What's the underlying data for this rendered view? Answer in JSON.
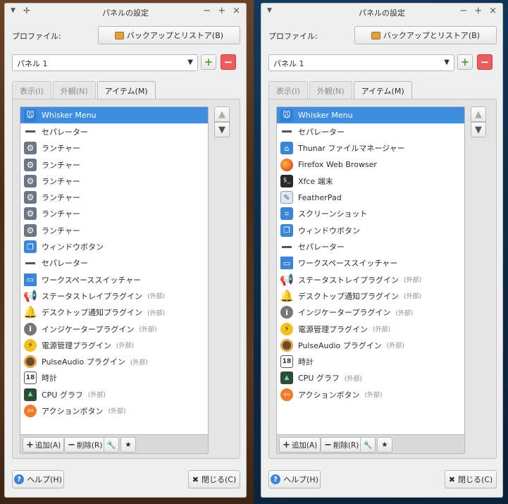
{
  "window": {
    "title": "パネルの設定",
    "profile_label": "プロファイル:",
    "backup_button": "バックアップとリストア(B)",
    "panel_select": "パネル 1",
    "add_symbol": "+",
    "remove_symbol": "−",
    "tabs": [
      "表示(I)",
      "外観(N)",
      "アイテム(M)"
    ],
    "toolbar": {
      "add": "追加(A)",
      "remove": "削除(R)"
    },
    "help_button": "ヘルプ(H)",
    "close_button": "閉じる(C)"
  },
  "left_items": [
    {
      "label": "Whisker Menu",
      "ext": "",
      "icon": "whisker-menu-icon",
      "selected": true
    },
    {
      "label": "セパレーター",
      "ext": "",
      "icon": "separator-icon"
    },
    {
      "label": "ランチャー",
      "ext": "",
      "icon": "launcher-gear-icon"
    },
    {
      "label": "ランチャー",
      "ext": "",
      "icon": "launcher-gear-icon"
    },
    {
      "label": "ランチャー",
      "ext": "",
      "icon": "launcher-gear-icon"
    },
    {
      "label": "ランチャー",
      "ext": "",
      "icon": "launcher-gear-icon"
    },
    {
      "label": "ランチャー",
      "ext": "",
      "icon": "launcher-gear-icon"
    },
    {
      "label": "ランチャー",
      "ext": "",
      "icon": "launcher-gear-icon"
    },
    {
      "label": "ウィンドウボタン",
      "ext": "",
      "icon": "window-buttons-icon"
    },
    {
      "label": "セパレーター",
      "ext": "",
      "icon": "separator-icon"
    },
    {
      "label": "ワークスペーススイッチャー",
      "ext": "",
      "icon": "workspace-switcher-icon"
    },
    {
      "label": "ステータストレイプラグイン",
      "ext": "(外部)",
      "icon": "status-tray-icon"
    },
    {
      "label": "デスクトップ通知プラグイン",
      "ext": "(外部)",
      "icon": "notification-bell-icon"
    },
    {
      "label": "インジケータープラグイン",
      "ext": "(外部)",
      "icon": "indicator-info-icon"
    },
    {
      "label": "電源管理プラグイン",
      "ext": "(外部)",
      "icon": "power-manager-icon"
    },
    {
      "label": "PulseAudio プラグイン",
      "ext": "(外部)",
      "icon": "pulseaudio-speaker-icon"
    },
    {
      "label": "時計",
      "ext": "",
      "icon": "clock-calendar-icon"
    },
    {
      "label": "CPU グラフ",
      "ext": "(外部)",
      "icon": "cpu-graph-icon"
    },
    {
      "label": "アクションボタン",
      "ext": "(外部)",
      "icon": "action-buttons-icon"
    }
  ],
  "right_items": [
    {
      "label": "Whisker Menu",
      "ext": "",
      "icon": "whisker-menu-icon",
      "selected": true
    },
    {
      "label": "セパレーター",
      "ext": "",
      "icon": "separator-icon"
    },
    {
      "label": "Thunar ファイルマネージャー",
      "ext": "",
      "icon": "home-folder-icon"
    },
    {
      "label": "Firefox Web Browser",
      "ext": "",
      "icon": "firefox-icon"
    },
    {
      "label": "Xfce 端末",
      "ext": "",
      "icon": "terminal-icon"
    },
    {
      "label": "FeatherPad",
      "ext": "",
      "icon": "featherpad-icon"
    },
    {
      "label": "スクリーンショット",
      "ext": "",
      "icon": "screenshot-icon"
    },
    {
      "label": "ウィンドウボタン",
      "ext": "",
      "icon": "window-buttons-icon"
    },
    {
      "label": "セパレーター",
      "ext": "",
      "icon": "separator-icon"
    },
    {
      "label": "ワークスペーススイッチャー",
      "ext": "",
      "icon": "workspace-switcher-icon"
    },
    {
      "label": "ステータストレイプラグイン",
      "ext": "(外部)",
      "icon": "status-tray-icon"
    },
    {
      "label": "デスクトップ通知プラグイン",
      "ext": "(外部)",
      "icon": "notification-bell-icon"
    },
    {
      "label": "インジケータープラグイン",
      "ext": "(外部)",
      "icon": "indicator-info-icon"
    },
    {
      "label": "電源管理プラグイン",
      "ext": "(外部)",
      "icon": "power-manager-icon"
    },
    {
      "label": "PulseAudio プラグイン",
      "ext": "(外部)",
      "icon": "pulseaudio-speaker-icon"
    },
    {
      "label": "時計",
      "ext": "",
      "icon": "clock-calendar-icon"
    },
    {
      "label": "CPU グラフ",
      "ext": "(外部)",
      "icon": "cpu-graph-icon"
    },
    {
      "label": "アクションボタン",
      "ext": "(外部)",
      "icon": "action-buttons-icon"
    }
  ],
  "icon_glyphs": {
    "whisker-menu-icon": "🐭",
    "separator-icon": "",
    "launcher-gear-icon": "⚙",
    "window-buttons-icon": "❐",
    "workspace-switcher-icon": "▭",
    "status-tray-icon": "📢",
    "notification-bell-icon": "🔔",
    "indicator-info-icon": "i",
    "power-manager-icon": "⚡",
    "pulseaudio-speaker-icon": "",
    "clock-calendar-icon": "18",
    "cpu-graph-icon": "▲",
    "action-buttons-icon": "⇦",
    "home-folder-icon": "⌂",
    "firefox-icon": "",
    "terminal-icon": "$_",
    "featherpad-icon": "✎",
    "screenshot-icon": "⌗"
  },
  "colors": {
    "selection": "#3d8ee0",
    "remove_button": "#ed5d5d",
    "add_button_plus": "#4aa52e"
  }
}
